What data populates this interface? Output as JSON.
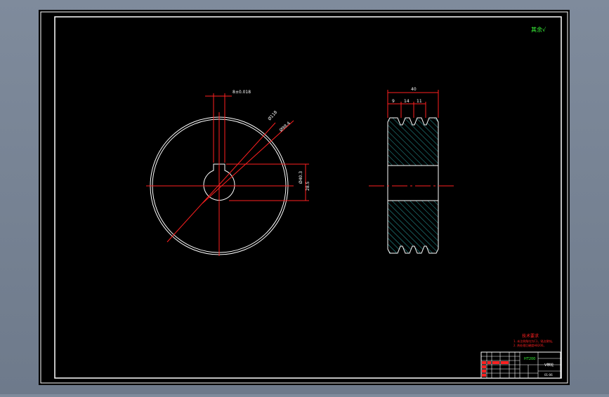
{
  "drawing": {
    "corner_note": "其余√",
    "front_view": {
      "dim_keyway_width": "8±0.018",
      "dim_outer_dia": "Ø118",
      "dim_inner_dia": "Ø98.4",
      "dim_bore": "Ø40.3",
      "dim_hub": "28.5"
    },
    "side_view": {
      "dim_total_width": "40",
      "dim_groove_a": "9",
      "dim_groove_b": "14",
      "dim_groove_c": "11"
    },
    "tech_requirements": {
      "heading": "技术要求",
      "line1": "1. 未注倒角均为C1，锐边倒钝。",
      "line2": "2. 热处理后硬度HB200。"
    },
    "title_block": {
      "material": "HT200",
      "part_name": "V带轮",
      "drawing_no": "01-06"
    }
  }
}
